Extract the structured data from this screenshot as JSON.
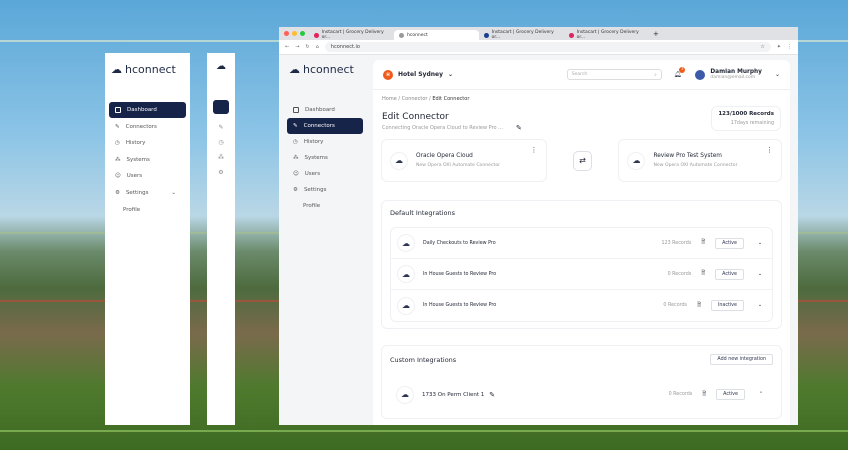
{
  "app": {
    "name": "hconnect"
  },
  "sidebar": {
    "items": [
      {
        "label": "Dashboard"
      },
      {
        "label": "Connectors"
      },
      {
        "label": "History"
      },
      {
        "label": "Systems"
      },
      {
        "label": "Users"
      },
      {
        "label": "Settings"
      }
    ],
    "sub": "Profile"
  },
  "browser": {
    "tabs": [
      {
        "label": "Instacart | Grocery Delivery or..."
      },
      {
        "label": "hconnect"
      },
      {
        "label": "Instacart | Grocery Delivery or..."
      },
      {
        "label": "Instacart | Grocery Delivery or..."
      }
    ],
    "url": "hconnect.io"
  },
  "header": {
    "hotel_initial": "H",
    "hotel": "Hotel Sydney",
    "search_placeholder": "Search",
    "notif_count": "3",
    "user_name": "Damian Murphy",
    "user_email": "damian@email.com"
  },
  "breadcrumb": [
    "Home",
    "Connector",
    "Edit Connector"
  ],
  "page": {
    "title": "Edit Connector",
    "subtitle": "Connecting Oracle Opera Cloud to Review Pro ...",
    "records": "123/1000 Records",
    "remaining": "17days remaining"
  },
  "connectors": [
    {
      "name": "Oracle Opera Cloud",
      "desc": "New Opera OXI Automate Connector"
    },
    {
      "name": "Review Pro Test System",
      "desc": "New Opera OXI Automate Connector"
    }
  ],
  "default": {
    "title": "Default Integrations",
    "rows": [
      {
        "name": "Daily Checkouts to Review  Pro",
        "records": "123 Records",
        "status": "Active"
      },
      {
        "name": "In House Guests to Review Pro",
        "records": "0 Records",
        "status": "Active"
      },
      {
        "name": "In House Guests to Review Pro",
        "records": "0 Records",
        "status": "Inactive"
      }
    ]
  },
  "custom": {
    "title": "Custom  Integrations",
    "add": "Add new integration",
    "rows": [
      {
        "name": "1733 On Perm Client 1",
        "records": "0 Records",
        "status": "Active"
      }
    ]
  },
  "colors": {
    "primary": "#16244a",
    "accent": "#f05a1c"
  }
}
